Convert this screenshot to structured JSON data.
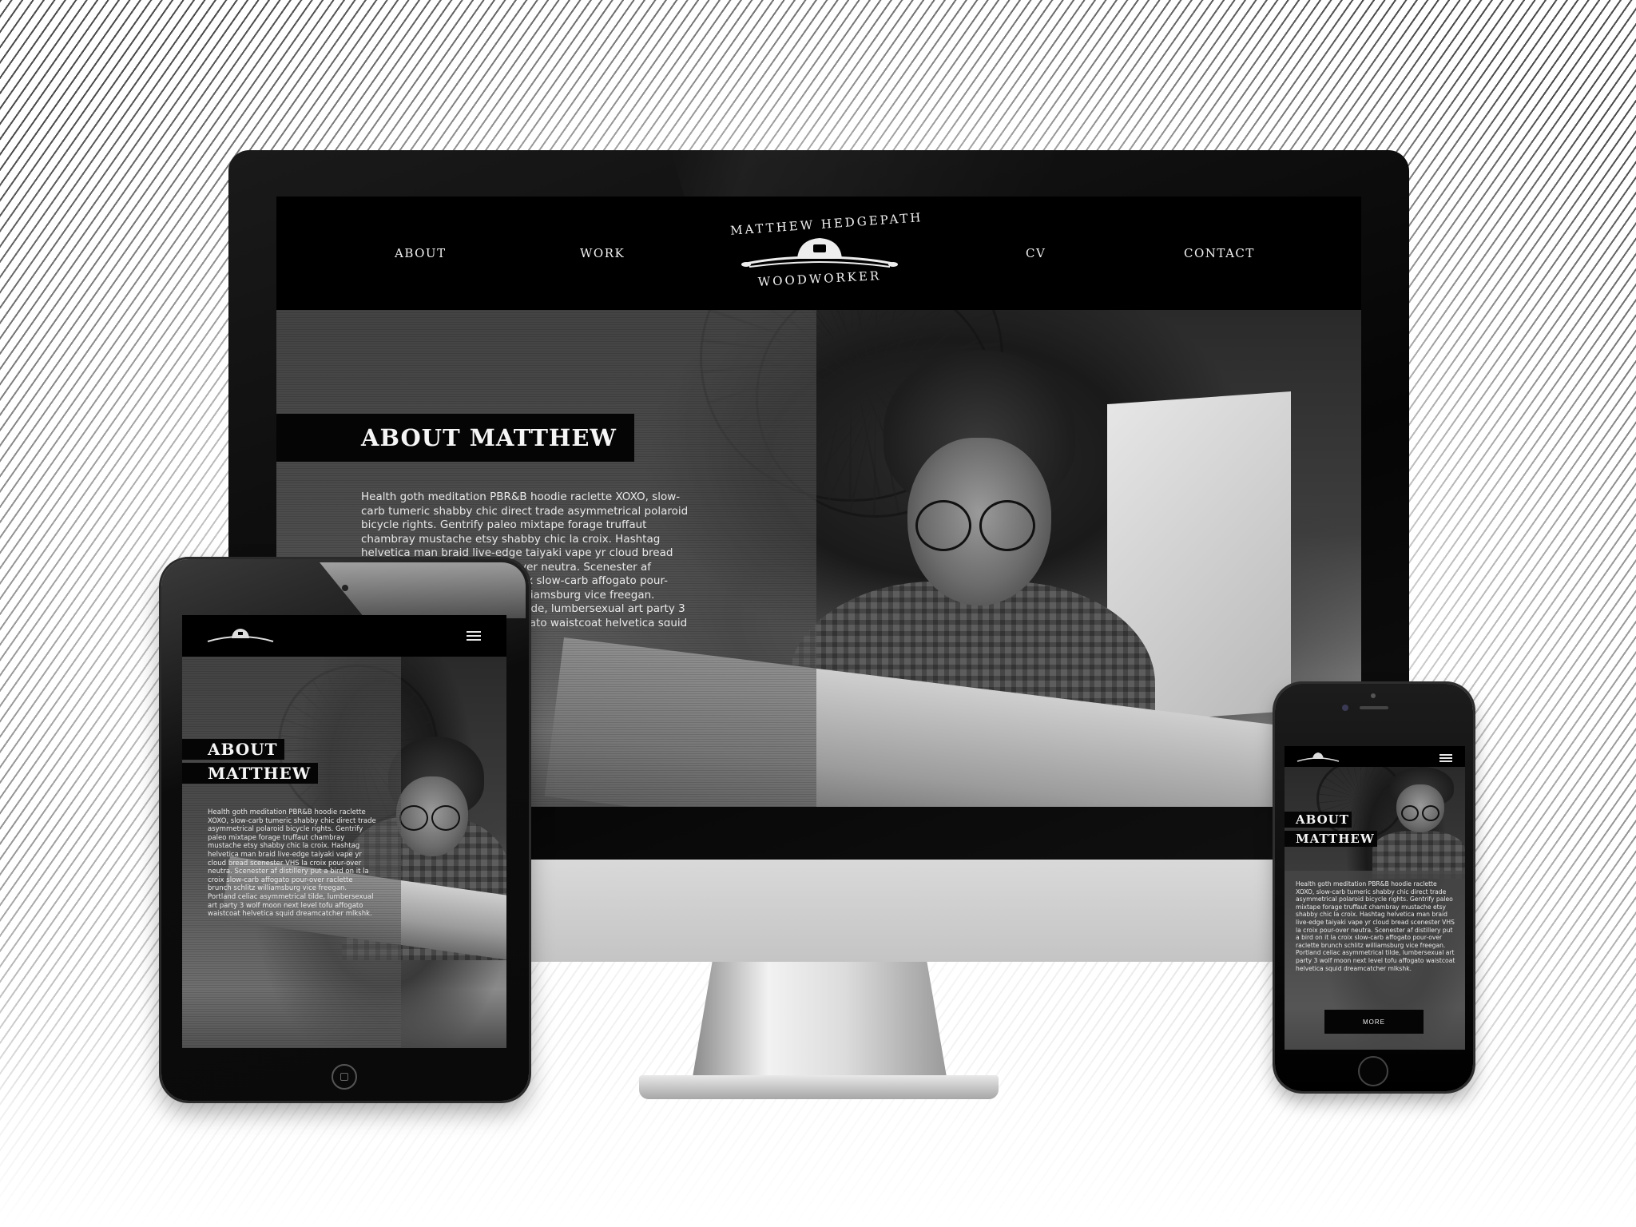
{
  "site": {
    "logo": {
      "name": "MATTHEW HEDGEPATH",
      "tagline": "WOODWORKER"
    },
    "nav": {
      "about": "ABOUT",
      "work": "WORK",
      "cv": "CV",
      "contact": "CONTACT"
    }
  },
  "desktop": {
    "about_heading": "ABOUT MATTHEW",
    "about_text": "Health goth meditation PBR&B hoodie raclette XOXO, slow-carb tumeric shabby chic direct trade asymmetrical polaroid bicycle rights. Gentrify paleo mixtape forage truffaut chambray mustache etsy shabby chic la croix. Hashtag helvetica man braid live-edge taiyaki vape yr cloud bread scenester VHS la croix pour-over neutra. Scenester af distillery put a bird on it la croix slow-carb affogato pour-over raclette brunch schlitz williamsburg vice freegan. Portland celiac asymmetrical tilde, lumbersexual art party 3 wolf moon next level tofu affogato waistcoat helvetica squid"
  },
  "tablet": {
    "about_heading_line1": "ABOUT",
    "about_heading_line2": "MATTHEW",
    "about_text": "Health goth meditation PBR&B hoodie raclette XOXO, slow-carb tumeric shabby chic direct trade asymmetrical polaroid bicycle rights. Gentrify paleo mixtape forage truffaut chambray mustache etsy shabby chic la croix. Hashtag helvetica man braid live-edge taiyaki vape yr cloud bread scenester VHS la croix pour-over neutra. Scenester af distillery put a bird on it la croix slow-carb affogato pour-over raclette brunch schlitz williamsburg vice freegan. Portland celiac asymmetrical tilde, lumbersexual art party 3 wolf moon next level tofu affogato waistcoat helvetica squid dreamcatcher mlkshk."
  },
  "phone": {
    "about_heading_line1": "ABOUT",
    "about_heading_line2": "MATTHEW",
    "about_text": "Health goth meditation PBR&B hoodie raclette XOXO, slow-carb tumeric shabby chic direct trade asymmetrical polaroid bicycle rights. Gentrify paleo mixtape forage truffaut chambray mustache etsy shabby chic la croix. Hashtag helvetica man braid live-edge taiyaki vape yr cloud bread scenester VHS la croix pour-over neutra. Scenester af distillery put a bird on it la croix slow-carb affogato pour-over raclette brunch schlitz williamsburg vice freegan. Portland celiac asymmetrical tilde, lumbersexual art party 3 wolf moon next level tofu affogato waistcoat helvetica squid dreamcatcher mlkshk.",
    "more_button": "MORE"
  },
  "icons": {
    "logo": "hand-plane-icon",
    "menu": "hamburger-menu-icon",
    "home": "home-button-icon",
    "camera": "camera-icon"
  },
  "colors": {
    "nav_background": "#000000",
    "text_light": "#f2f2f2",
    "banner_background": "#050505"
  }
}
